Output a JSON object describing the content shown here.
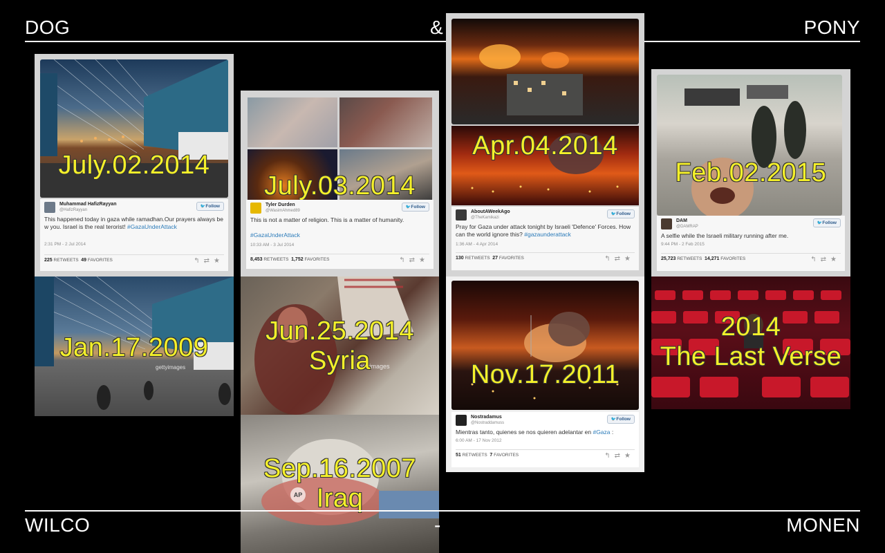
{
  "header": {
    "left": "DOG",
    "center": "&",
    "right": "PONY"
  },
  "footer": {
    "left": "WILCO",
    "center": "-",
    "right": "MONEN"
  },
  "colors": {
    "background": "#000000",
    "label": "#f4f02a",
    "text": "#ffffff",
    "twitter_blue": "#55acee",
    "hashtag": "#2b7bb9"
  },
  "tweets": [
    {
      "date_label": "July.02.2014",
      "name": "Muhammad HafizRayyan",
      "handle": "@HafizRayyan",
      "follow": "Follow",
      "text": "This happened today in gaza while ramadhan.Our prayers always be w you. Israel is the real terorist! ",
      "hashtag": "#GazaUnderAttack",
      "timestamp": "2:31 PM - 2 Jul 2014",
      "retweets": "225",
      "favorites": "49",
      "retweets_label": "RETWEETS",
      "favorites_label": "FAVORITES"
    },
    {
      "date_label": "July.03.2014",
      "name": "Tyler Durden",
      "handle": "@WasimAhmed89",
      "follow": "Follow",
      "text": "This is not a matter of religion. This is a matter of humanity.",
      "hashtag": "#GazaUnderAttack",
      "timestamp": "10:33 AM - 3 Jul 2014",
      "retweets": "8,453",
      "favorites": "1,752",
      "retweets_label": "RETWEETS",
      "favorites_label": "FAVORITES"
    },
    {
      "date_label": "Apr.04.2014",
      "name": "AboutAWeekAgo",
      "handle": "@TheKamikazi",
      "follow": "Follow",
      "text": "Pray for Gaza under attack tonight by Israeli 'Defence' Forces. How can the world ignore this? ",
      "hashtag": "#gazaunderattack",
      "timestamp": "1:36 AM - 4 Apr 2014",
      "retweets": "130",
      "favorites": "27",
      "retweets_label": "RETWEETS",
      "favorites_label": "FAVORITES"
    },
    {
      "date_label": "Feb.02.2015",
      "name": "DAM",
      "handle": "@DAMRAP",
      "follow": "Follow",
      "text": "A selfie while the Israeli military running after me.",
      "hashtag": "",
      "timestamp": "9:44 PM - 2 Feb 2015",
      "retweets": "25,723",
      "favorites": "14,271",
      "retweets_label": "RETWEETS",
      "favorites_label": "FAVORITES"
    },
    {
      "date_label": "Nov.17.2011",
      "name": "Nostradamus",
      "handle": "@Nostraddamuss",
      "follow": "Follow",
      "text": "Mientras tanto, quienes se nos quieren adelantar en ",
      "hashtag": "#Gaza",
      "text_after": " :",
      "timestamp": "6:00 AM - 17 Nov 2012",
      "retweets": "51",
      "favorites": "7",
      "retweets_label": "RETWEETS",
      "favorites_label": "FAVORITES"
    }
  ],
  "photos": [
    {
      "label_line1": "Jan.17.2009",
      "label_line2": "",
      "watermark": "gettyimages"
    },
    {
      "label_line1": "Jun.25.2014",
      "label_line2": "Syria",
      "watermark": "gettyimages"
    },
    {
      "label_line1": "Sep.16.2007",
      "label_line2": "Iraq",
      "watermark": "AP"
    },
    {
      "label_line1": "2014",
      "label_line2": "The Last Verse",
      "watermark": ""
    }
  ],
  "icons": {
    "reply": "reply-icon",
    "retweet": "retweet-icon",
    "favorite": "star-icon",
    "bird": "twitter-bird-icon"
  }
}
